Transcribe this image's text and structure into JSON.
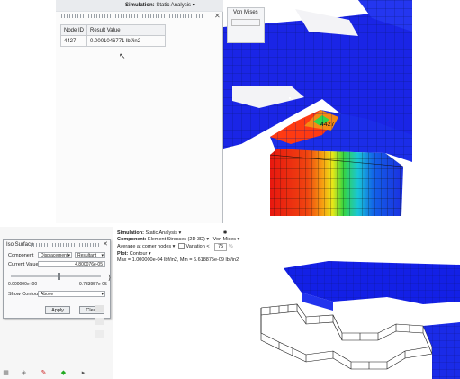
{
  "top": {
    "simulation_label": "Simulation:",
    "simulation_value": "Static Analysis",
    "dropdown_value": "Von Mises",
    "table": {
      "headers": [
        "Node ID",
        "Result Value"
      ],
      "rows": [
        [
          "4427",
          "0.0001046771 lbf/in2"
        ]
      ]
    },
    "node_tag": "4427"
  },
  "bottom": {
    "iso": {
      "title": "Iso Surface",
      "component_label": "Component",
      "component_value": "Displacement",
      "resultant_value": "Resultant",
      "current_value_label": "Current Value",
      "current_value": "4.800076e-05",
      "min_value": "0.000000e+00",
      "max_value": "9.733957e-05",
      "show_contour_label": "Show Contour",
      "show_contour_value": "Above",
      "apply_label": "Apply",
      "clear_label": "Clear"
    },
    "sim": {
      "simulation_label": "Simulation:",
      "simulation_value": "Static Analysis",
      "component_label": "Component:",
      "component_value": "Element Stresses (2D  3D)",
      "component_result": "Von Mises",
      "averaging_value": "Average at corner nodes",
      "variation_label": "Variation <",
      "variation_value": "75",
      "plot_label": "Plot:",
      "plot_value": "Contour",
      "max_text": "Max = 1.000000e-04 lbf/in2, Min = 6.618875e-09 lbf/in2"
    }
  }
}
